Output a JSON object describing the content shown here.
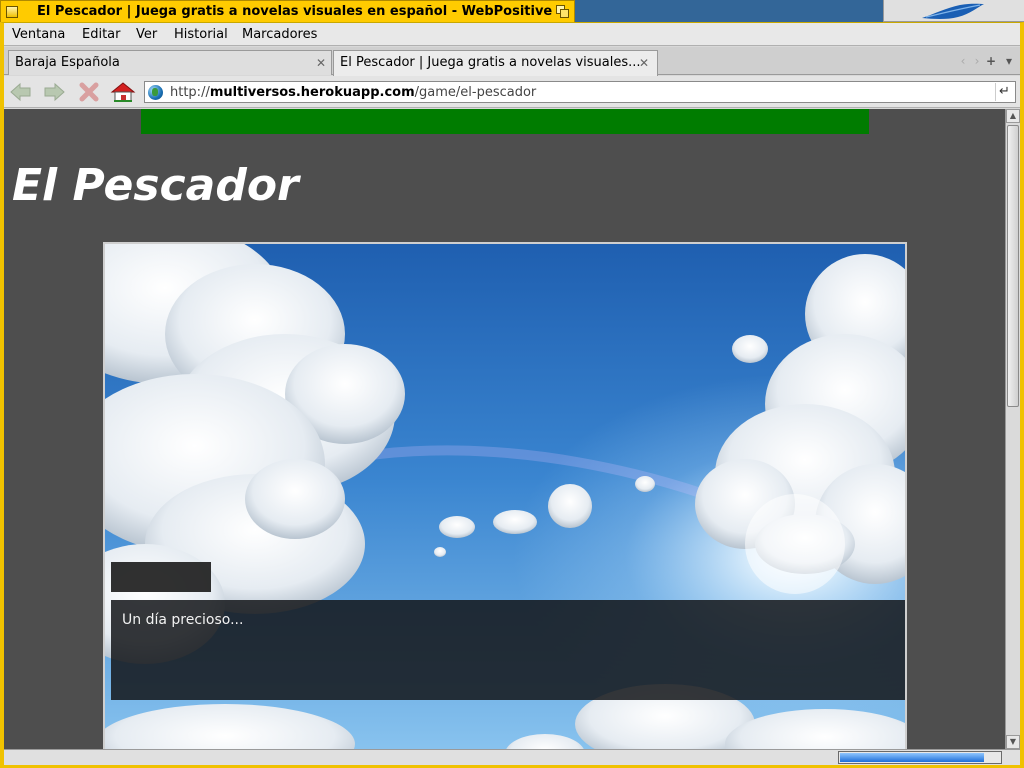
{
  "window": {
    "title": "El Pescador | Juega gratis a novelas visuales en español - WebPositive"
  },
  "menu": {
    "items": [
      "Ventana",
      "Editar",
      "Ver",
      "Historial",
      "Marcadores"
    ]
  },
  "tabs": [
    {
      "label": "Baraja Española",
      "active": false
    },
    {
      "label": "El Pescador | Juega gratis a novelas visuales...",
      "active": true
    }
  ],
  "tab_controls": {
    "new_tab": "+",
    "list": "▾"
  },
  "address": {
    "prefix": "http://",
    "host": "multiversos.herokuapp.com",
    "path": "/game/el-pescador"
  },
  "page": {
    "title": "El Pescador",
    "banner_color": "#007c00",
    "background_color": "#4e4e4e"
  },
  "game": {
    "speaker_name": "",
    "dialog_text": "Un día precioso..."
  },
  "status": {
    "progress": 0.9
  },
  "colors": {
    "title_bar": "#ffcb00",
    "desktop": "#336698"
  }
}
